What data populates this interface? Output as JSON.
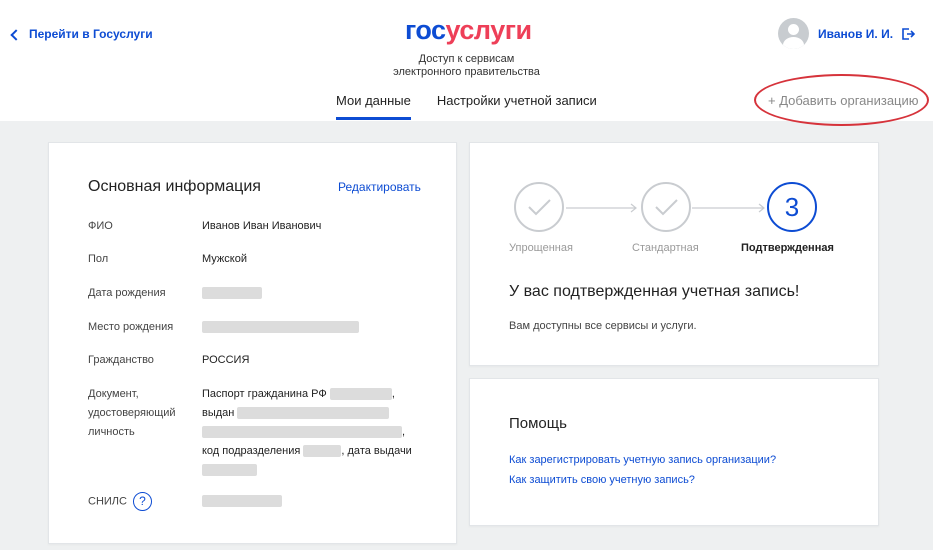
{
  "header": {
    "back_label": "Перейти в Госуслуги",
    "logo_part1": "гос",
    "logo_part2": "услуги",
    "subtitle_line1": "Доступ к сервисам",
    "subtitle_line2": "электронного правительства",
    "user_name": "Иванов И. И.",
    "tabs": [
      {
        "label": "Мои данные",
        "active": true
      },
      {
        "label": "Настройки учетной записи",
        "active": false
      }
    ],
    "add_org_label": "+ Добавить организацию",
    "brand_blue": "#0d4cd3",
    "brand_red": "#ee3f58"
  },
  "main_info": {
    "title": "Основная информация",
    "edit_label": "Редактировать",
    "rows": [
      {
        "label": "ФИО",
        "value": "Иванов Иван Иванович"
      },
      {
        "label": "Пол",
        "value": "Мужской"
      },
      {
        "label": "Дата рождения",
        "value": ""
      },
      {
        "label": "Место рождения",
        "value": ""
      },
      {
        "label": "Гражданство",
        "value": "РОССИЯ"
      }
    ],
    "document": {
      "label_line1": "Документ,",
      "label_line2": "удостоверяющий",
      "label_line3": "личность",
      "line1_prefix": "Паспорт гражданина РФ",
      "line1_suffix": ",",
      "line2_prefix": "выдан",
      "line3_suffix": ",",
      "line4_prefix": "код подразделения",
      "line4_middle": ", дата выдачи"
    },
    "snils_label": "СНИЛС",
    "snils_help": "?"
  },
  "account_level": {
    "steps": [
      {
        "label": "Упрощенная",
        "state": "done"
      },
      {
        "label": "Стандартная",
        "state": "done"
      },
      {
        "label": "Подтвержденная",
        "state": "current",
        "number": "3"
      }
    ],
    "status_title": "У вас подтвержденная учетная запись!",
    "status_sub": "Вам доступны все сервисы и услуги."
  },
  "help": {
    "title": "Помощь",
    "links": [
      "Как зарегистрировать учетную запись организации?",
      "Как защитить свою учетную запись?"
    ]
  }
}
